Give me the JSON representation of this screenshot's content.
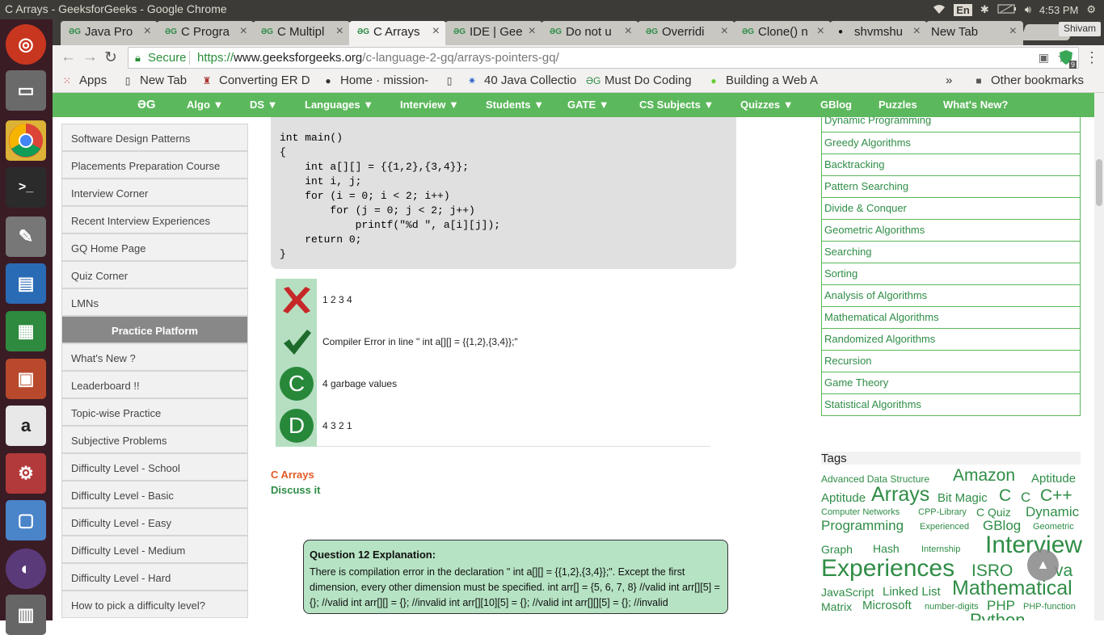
{
  "system": {
    "window_title": "C Arrays - GeeksforGeeks - Google Chrome",
    "keyboard_layout": "En",
    "time": "4:53 PM"
  },
  "tabs": [
    {
      "label": "Java Pro",
      "icon": "gfg-icon",
      "active": false
    },
    {
      "label": "C Progra",
      "icon": "gfg-icon",
      "active": false
    },
    {
      "label": "C Multipl",
      "icon": "gfg-icon",
      "active": false
    },
    {
      "label": "C Arrays",
      "icon": "gfg-icon",
      "active": true
    },
    {
      "label": "IDE | Gee",
      "icon": "gfg-icon",
      "active": false
    },
    {
      "label": "Do not u",
      "icon": "gfg-icon",
      "active": false
    },
    {
      "label": "Overridi",
      "icon": "gfg-icon",
      "active": false
    },
    {
      "label": "Clone() n",
      "icon": "gfg-icon",
      "active": false
    },
    {
      "label": "shvmshu",
      "icon": "github-icon",
      "active": false
    },
    {
      "label": "New Tab",
      "icon": "",
      "active": false
    }
  ],
  "profile_name": "Shivam",
  "omnibox": {
    "secure_label": "Secure",
    "scheme": "https://",
    "host": "www.geeksforgeeks.org",
    "path": "/c-language-2-gq/arrays-pointers-gq/",
    "extension_badge": "9"
  },
  "bookmarks": [
    {
      "label": "Apps",
      "icon": "apps-grid-icon"
    },
    {
      "label": "New Tab",
      "icon": "page-icon"
    },
    {
      "label": "Converting ER D",
      "icon": "site-icon"
    },
    {
      "label": "Home · mission-",
      "icon": "github-icon"
    },
    {
      "label": "",
      "icon": "page-icon"
    },
    {
      "label": "40 Java Collectio",
      "icon": "site-icon"
    },
    {
      "label": "Must Do Coding",
      "icon": "gfg-icon"
    },
    {
      "label": "Building a Web A",
      "icon": "leaf-icon"
    }
  ],
  "other_bookmarks": "Other bookmarks",
  "gfg_nav": {
    "logo": "ƏG",
    "items": [
      "Algo ▼",
      "DS ▼",
      "Languages ▼",
      "Interview ▼",
      "Students ▼",
      "GATE ▼",
      "CS Subjects ▼",
      "Quizzes ▼",
      "GBlog",
      "Puzzles",
      "What's New?"
    ]
  },
  "left_menu": [
    "Software Design Patterns",
    "Placements Preparation Course",
    "Interview Corner",
    "Recent Interview Experiences",
    "GQ Home Page",
    "Quiz Corner",
    "LMNs",
    "Practice Platform",
    "What's New ?",
    "Leaderboard !!",
    "Topic-wise Practice",
    "Subjective Problems",
    "Difficulty Level - School",
    "Difficulty Level - Basic",
    "Difficulty Level - Easy",
    "Difficulty Level - Medium",
    "Difficulty Level - Hard",
    "How to pick a difficulty level?"
  ],
  "code": "int main()\n{\n    int a[][] = {{1,2},{3,4}};\n    int i, j;\n    for (i = 0; i < 2; i++)\n        for (j = 0; j < 2; j++)\n            printf(\"%d \", a[i][j]);\n    return 0;\n}",
  "options": [
    {
      "mark": "wrong-cross-icon",
      "label": "",
      "text": "1 2 3 4"
    },
    {
      "mark": "correct-check-icon",
      "label": "",
      "text": "Compiler Error in line \" int a[][] = {{1,2},{3,4}};\""
    },
    {
      "mark": "option-c-icon",
      "label": "C",
      "text": "4 garbage values"
    },
    {
      "mark": "option-d-icon",
      "label": "D",
      "text": "4 3 2 1"
    }
  ],
  "question_tag": "C Arrays",
  "discuss_link": "Discuss it",
  "explanation": {
    "heading": "Question 12 Explanation:",
    "body": "There is compilation error in the declaration \" int a[][] = {{1,2},{3,4}};\". Except the first dimension, every other dimension must be specified. int arr[] = {5, 6, 7, 8} //valid int arr[][5] = {}; //valid int arr[][] = {}; //invalid int arr[][10][5] = {}; //valid int arr[][][5] = {}; //invalid"
  },
  "right_list": [
    "Dynamic Programming",
    "Greedy Algorithms",
    "Backtracking",
    "Pattern Searching",
    "Divide & Conquer",
    "Geometric Algorithms",
    "Searching",
    "Sorting",
    "Analysis of Algorithms",
    "Mathematical Algorithms",
    "Randomized Algorithms",
    "Recursion",
    "Game Theory",
    "Statistical Algorithms"
  ],
  "tags_heading": "Tags",
  "tags": [
    "Advanced Data Structure",
    "Amazon",
    "Aptitude",
    "Aptitude",
    "Arrays",
    "Bit Magic",
    "C",
    "C",
    "C++",
    "Computer Networks",
    "CPP-Library",
    "C Quiz",
    "Dynamic",
    "Programming",
    "Experienced",
    "GBlog",
    "Geometric",
    "Graph",
    "Hash",
    "Internship",
    "Interview",
    "Experiences",
    "ISRO",
    "va",
    "JavaScript",
    "Linked List",
    "Mathematical",
    "Matrix",
    "Microsoft",
    "number-digits",
    "PHP",
    "PHP-function",
    "Python"
  ],
  "scroll_top_glyph": "▲",
  "colors": {
    "gfg_green": "#5cb85c",
    "link_green": "#2f8d46",
    "tag_orange": "#e05a28"
  }
}
